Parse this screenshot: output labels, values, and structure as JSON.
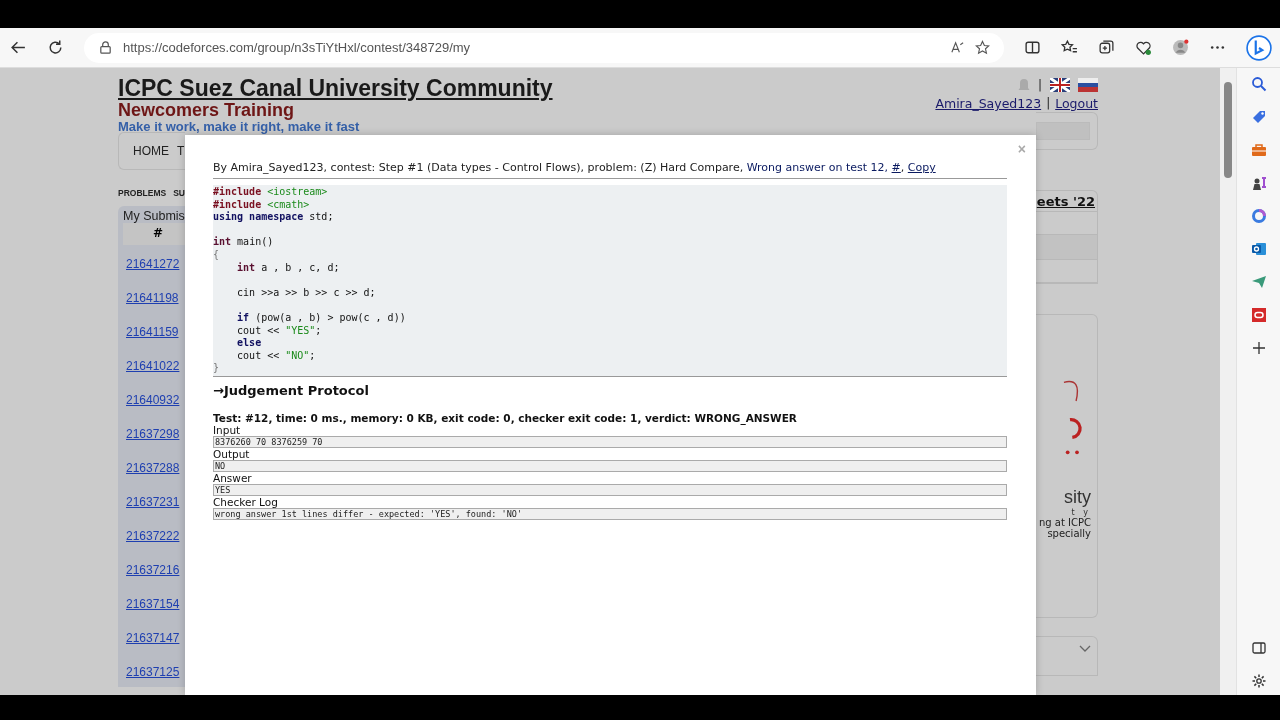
{
  "browser": {
    "url": "https://codeforces.com/group/n3sTiYtHxl/contest/348729/my"
  },
  "page": {
    "title": "ICPC Suez Canal University Community",
    "subtitle": "Newcomers Training",
    "tagline": "Make it work, make it right, make it fast",
    "user": "Amira_Sayed123",
    "separator": "|",
    "logout": "Logout",
    "nav": [
      "HOME",
      "T"
    ],
    "subnav": [
      "PROBLEMS",
      "SU"
    ],
    "submissions_title": "My Submis",
    "column_1": "#",
    "ids": [
      "21641272",
      "21641198",
      "21641159",
      "21641022",
      "21640932",
      "21637298",
      "21637288",
      "21637231",
      "21637222",
      "21637216",
      "21637154",
      "21637147",
      "21637125"
    ],
    "sidebar_heading": "eets '22",
    "logo_text": [
      "sity",
      "t y"
    ],
    "sidebar_text": [
      "ng at ICPC",
      "specially"
    ]
  },
  "modal": {
    "close": "×",
    "header": [
      {
        "kind": "text",
        "text": "By Amira_Sayed123, contest: Step #1 (Data types - Control Flows), problem: (Z) Hard Compare, "
      },
      {
        "kind": "verdict",
        "text": "Wrong answer on test 12, "
      },
      {
        "kind": "link",
        "text": "#"
      },
      {
        "kind": "text",
        "text": ", "
      },
      {
        "kind": "link",
        "text": "Copy"
      }
    ],
    "code": [
      {
        "kind": "code",
        "tokens": [
          {
            "kind": "pre",
            "t": "#include "
          },
          {
            "kind": "str",
            "t": "<iostream>"
          }
        ]
      },
      {
        "kind": "code",
        "tokens": [
          {
            "kind": "pre",
            "t": "#include "
          },
          {
            "kind": "str",
            "t": "<cmath>"
          }
        ]
      },
      {
        "kind": "code",
        "tokens": [
          {
            "kind": "kw",
            "t": "using namespace "
          },
          {
            "kind": "plain",
            "t": "std;"
          }
        ]
      },
      {
        "kind": "blank"
      },
      {
        "kind": "code",
        "tokens": [
          {
            "kind": "type",
            "t": "int "
          },
          {
            "kind": "plain",
            "t": "main()"
          }
        ]
      },
      {
        "kind": "code",
        "tokens": [
          {
            "kind": "punct",
            "t": "{"
          }
        ]
      },
      {
        "kind": "code",
        "tokens": [
          {
            "kind": "type",
            "t": "    int "
          },
          {
            "kind": "plain",
            "t": "a , b , c, d;"
          }
        ]
      },
      {
        "kind": "blank"
      },
      {
        "kind": "code",
        "tokens": [
          {
            "kind": "plain",
            "t": "    cin >>a >> b >> c >> d;"
          }
        ]
      },
      {
        "kind": "blank"
      },
      {
        "kind": "code",
        "tokens": [
          {
            "kind": "kw",
            "t": "    if "
          },
          {
            "kind": "plain",
            "t": "(pow(a , b) > pow(c , d))"
          }
        ]
      },
      {
        "kind": "code",
        "tokens": [
          {
            "kind": "plain",
            "t": "    cout << "
          },
          {
            "kind": "str",
            "t": "\"YES\""
          },
          {
            "kind": "plain",
            "t": ";"
          }
        ]
      },
      {
        "kind": "code",
        "tokens": [
          {
            "kind": "kw",
            "t": "    else"
          }
        ]
      },
      {
        "kind": "code",
        "tokens": [
          {
            "kind": "plain",
            "t": "    cout << "
          },
          {
            "kind": "str",
            "t": "\"NO\""
          },
          {
            "kind": "plain",
            "t": ";"
          }
        ]
      },
      {
        "kind": "code",
        "tokens": [
          {
            "kind": "punct",
            "t": "}"
          }
        ]
      }
    ],
    "protocol_heading": "→Judgement Protocol",
    "test_summary": "Test: #12, time: 0 ms., memory: 0 KB, exit code: 0, checker exit code: 1, verdict: WRONG_ANSWER",
    "sections": [
      {
        "label": "Input",
        "value": "8376260 70 8376259 70"
      },
      {
        "label": "Output",
        "value": "NO"
      },
      {
        "label": "Answer",
        "value": "YES"
      },
      {
        "label": "Checker Log",
        "value": "wrong answer 1st lines differ - expected: 'YES', found: 'NO'"
      }
    ]
  }
}
